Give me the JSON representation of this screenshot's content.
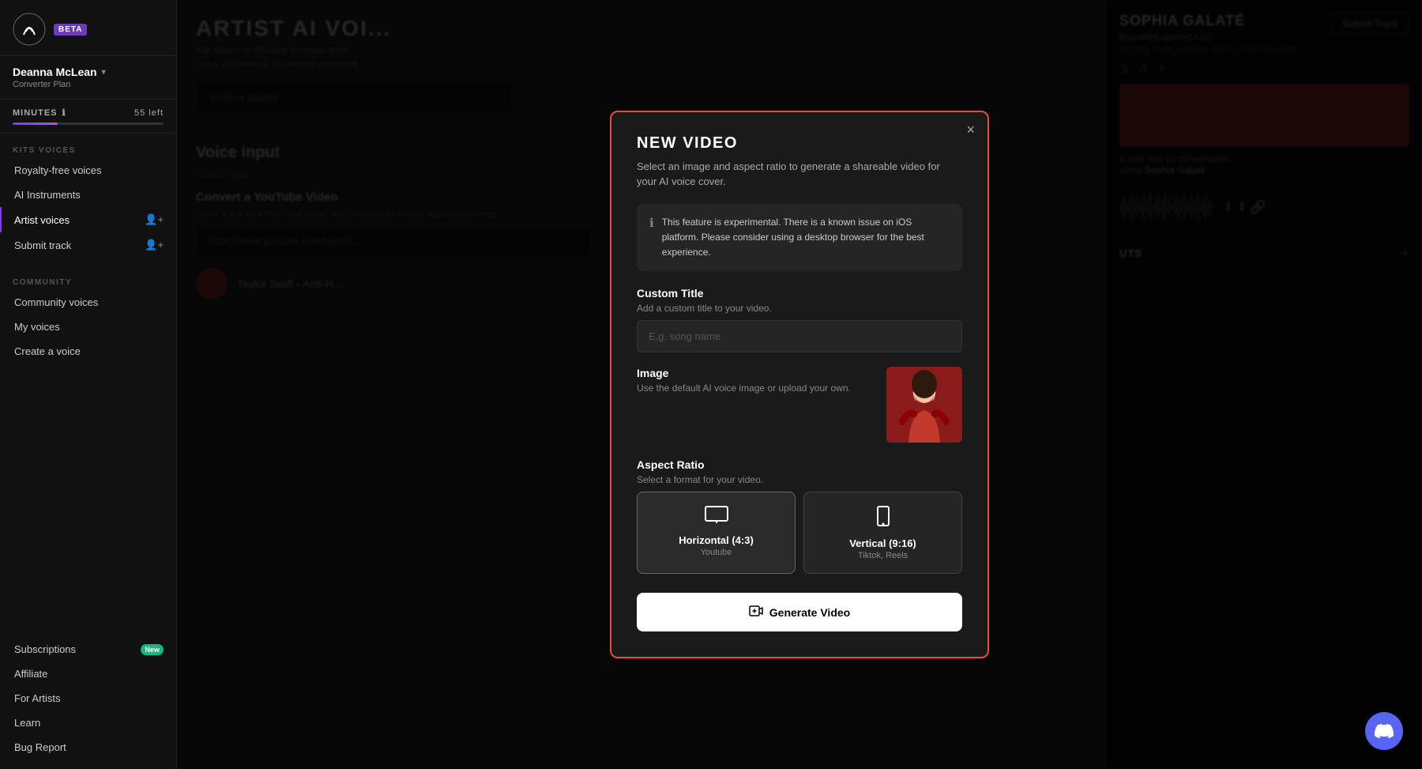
{
  "sidebar": {
    "beta_label": "BETA",
    "user": {
      "name": "Deanna McLean",
      "plan": "Converter Plan"
    },
    "minutes": {
      "label": "MINUTES",
      "left": "55 left",
      "progress": 30
    },
    "kits_voices_label": "KITS VOICES",
    "nav_kits": [
      {
        "id": "royalty-free",
        "label": "Royalty-free voices",
        "icon": "🎵",
        "active": false
      },
      {
        "id": "ai-instruments",
        "label": "AI Instruments",
        "icon": "🎹",
        "active": false
      },
      {
        "id": "artist-voices",
        "label": "Artist voices",
        "icon": "🎤",
        "active": true
      },
      {
        "id": "submit-track",
        "label": "Submit track",
        "icon": "➕",
        "active": false
      }
    ],
    "community_label": "COMMUNITY",
    "nav_community": [
      {
        "id": "community-voices",
        "label": "Community voices",
        "active": false
      },
      {
        "id": "my-voices",
        "label": "My voices",
        "active": false
      },
      {
        "id": "create-voice",
        "label": "Create a voice",
        "active": false
      }
    ],
    "nav_bottom": [
      {
        "id": "subscriptions",
        "label": "Subscriptions",
        "badge": "New"
      },
      {
        "id": "affiliate",
        "label": "Affiliate"
      },
      {
        "id": "for-artists",
        "label": "For Artists"
      },
      {
        "id": "learn",
        "label": "Learn"
      },
      {
        "id": "bug-report",
        "label": "Bug Report"
      }
    ]
  },
  "main": {
    "title": "ARTIST AI VOI...",
    "subtitle_line1": "Kits library of officially licensed artist",
    "subtitle_line2": "For a commercial co-release alongside",
    "search_placeholder": "Sophia Galaté",
    "voice_input_title": "Voice input",
    "audio_file_tab": "AUDIO FILE",
    "youtube_section": {
      "title": "Convert a YouTube Video",
      "description": "Enter a link to a YouTube video and selected AI model. Max video lengt...",
      "input_placeholder": "https://www.youtube.com/watch..."
    },
    "video_title": "Taylor Swift - Anti-H..."
  },
  "right_panel": {
    "artist_name": "SOPHIA GALATÉ",
    "royalties": "Royalties applied • 50",
    "tags": "Singing, Pure, Smooth, Warm, Pop, Rn8, Jazz",
    "submit_track_label": "Submit Track",
    "last_conversions_text": "s your last 10 conversions.",
    "using_text": "using",
    "using_artist": "Sophia Galaté",
    "outputs_label": "UTS",
    "plus_icon": "+"
  },
  "modal": {
    "title": "NEW VIDEO",
    "subtitle": "Select an image and aspect ratio to generate a shareable video for your AI voice cover.",
    "close_label": "×",
    "info_text": "This feature is experimental. There is a known issue on iOS platform. Please consider using a desktop browser for the best experience.",
    "custom_title_label": "Custom Title",
    "custom_title_desc": "Add a custom title to your video.",
    "custom_title_placeholder": "E.g. song name",
    "image_label": "Image",
    "image_desc": "Use the default AI voice image or upload your own.",
    "aspect_ratio_label": "Aspect Ratio",
    "aspect_ratio_desc": "Select a format for your video.",
    "aspect_options": [
      {
        "id": "horizontal",
        "title": "Horizontal (4:3)",
        "subtitle": "Youtube",
        "icon": "🖥",
        "selected": true
      },
      {
        "id": "vertical",
        "title": "Vertical (9:16)",
        "subtitle": "Tiktok, Reels",
        "icon": "📱",
        "selected": false
      }
    ],
    "generate_btn_label": "Generate Video"
  },
  "discord": {
    "icon": "💬"
  }
}
